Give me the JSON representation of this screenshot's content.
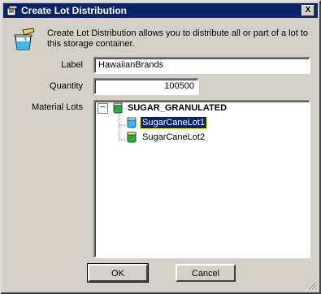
{
  "window": {
    "title": "Create Lot Distribution",
    "close_label": "X"
  },
  "description": "Create Lot Distribution allows you to distribute all or part of a lot to this storage container.",
  "form": {
    "label_caption": "Label",
    "label_value": "HawaiianBrands",
    "quantity_caption": "Quantity",
    "quantity_value": "100500",
    "lots_caption": "Material Lots"
  },
  "tree": {
    "root": {
      "label": "SUGAR_GRANULATED",
      "expander": "−"
    },
    "children": [
      {
        "label": "SugarCaneLot1",
        "selected": true
      },
      {
        "label": "SugarCaneLot2",
        "selected": false
      }
    ]
  },
  "buttons": {
    "ok": "OK",
    "cancel": "Cancel"
  },
  "icons": {
    "title": "window-app-icon",
    "description": "beaker-pour-icon",
    "lot": "material-lot-icon"
  }
}
